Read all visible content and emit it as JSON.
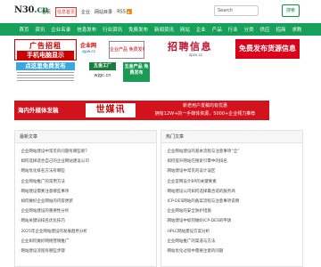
{
  "header": {
    "logo_main": "N30",
    "logo_suffix": ".cn",
    "top_links": [
      "首页",
      "信息首页",
      "企业",
      "网站目录",
      "RSS"
    ],
    "active_index": 1,
    "search_placeholder": "Search",
    "search_button": "搜索"
  },
  "main_nav": [
    "首页",
    "资讯",
    "企业名录",
    "信息发布",
    "行业资讯",
    "免费发布",
    "新闻资讯",
    "网站",
    "企业",
    "产品",
    "行业",
    "分类",
    "供应",
    "招商",
    "求购"
  ],
  "banners": {
    "b1_line1": "广告招租",
    "b1_line2": "手机电脑显示",
    "b2_logo": "企业网",
    "b2_url": "qyw.cc",
    "b2_box": "企业产品 免费发布",
    "b3_big": "招聘信息",
    "b3_small": "zpxx.cc",
    "b4_text": "免费发布货源信息",
    "b5_title": "点这里免费发布",
    "b6_top": "五金工厂",
    "b6_url": "wjgc.cn",
    "b7_text": "五金产品 免费发布"
  },
  "wide_ad": {
    "left_text": "海内外媒体发稿",
    "brand": "世媒讯",
    "line1": "新老用户发稿均有优惠",
    "line2": "拥有12W+的一手媒体资源，5000+企业倾力推荐"
  },
  "panels": {
    "left": {
      "title": "最新文章",
      "items": [
        "企业网站建设中常见的问题有哪些呢？",
        "如何选择适合自己的企业网站建设公司",
        "网站优化排名方法有哪些",
        "企业网站推广的常用方法",
        "网站建设需要注意哪些事项",
        "如何做好企业网站的内容更新",
        "企业网站建设的重要性分析",
        "网站关键词排名优化技巧",
        "2025年企业网站建设的发展趋势分析",
        "企业如何做好网络营销推广",
        "网站建设流程有哪些步骤"
      ]
    },
    "right": {
      "title": "热门文章",
      "items": [
        "企业网站建设的基本流程与注意事项“全”",
        "如何提升网站在搜索引擎中的排名",
        "网站建设中常见的设计误区",
        "企业官网设计BP的关键要素",
        "网站建设公司如何选择最合适的服务商",
        "ICP-DES网站的备案流程与注意事项说明",
        "企业网站的安全防护措施",
        "网站建设中如何做好ICP-DES的申请",
        "HPLC网站建设方案分析",
        "企业网站推广的渠道与方法",
        "网站优化过程中需要注意的问题"
      ]
    }
  }
}
